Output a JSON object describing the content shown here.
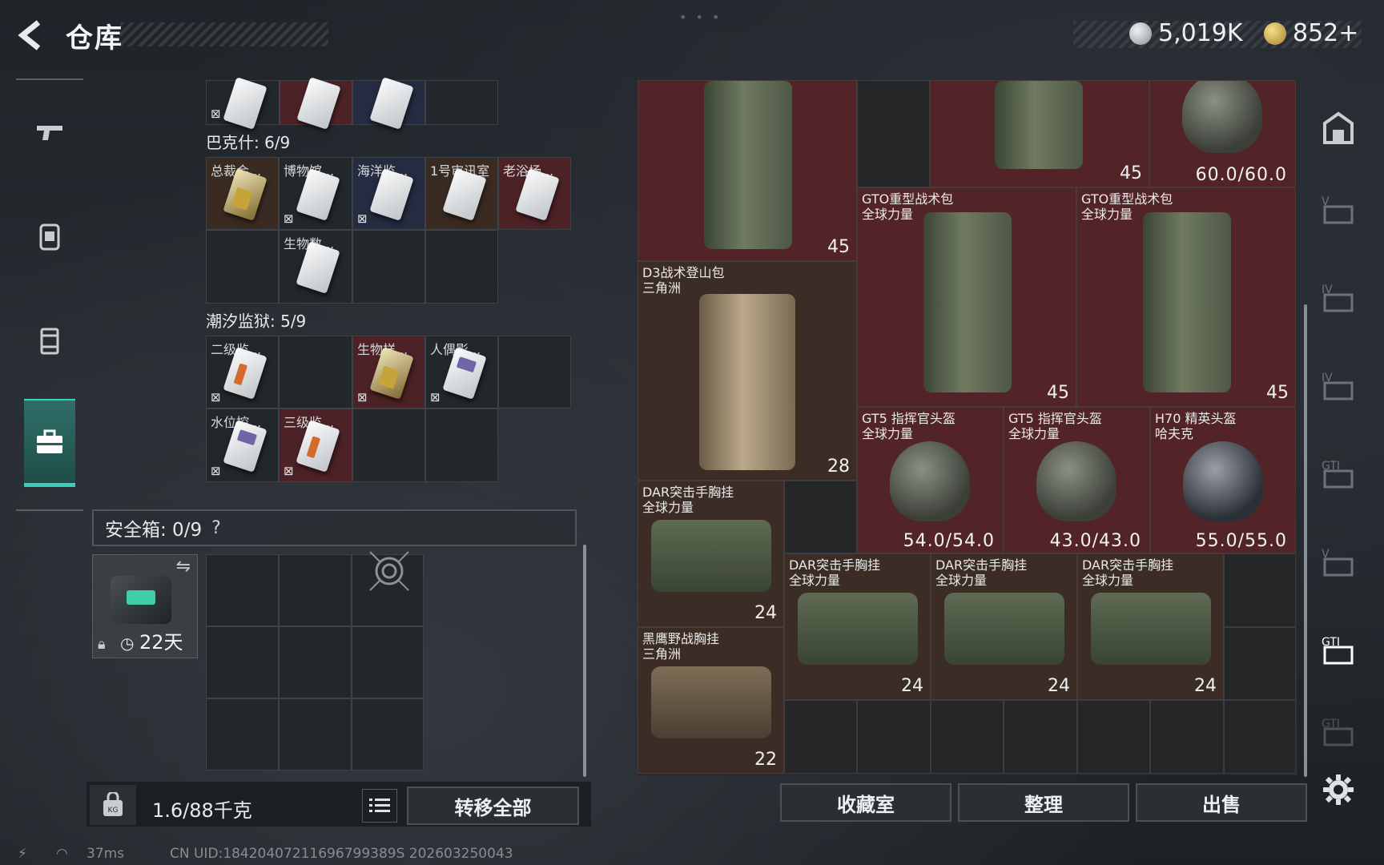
{
  "header": {
    "title": "仓库",
    "currency_silver": "5,019K",
    "currency_gold": "852+",
    "version_text": "--- --- ---"
  },
  "left_panel": {
    "sections": [
      {
        "label": "巴克什: 6/9"
      },
      {
        "label": "潮汐监狱: 5/9"
      }
    ],
    "bakhsh_items": [
      {
        "name": "总裁会..."
      },
      {
        "name": "博物馆..."
      },
      {
        "name": "海洋监..."
      },
      {
        "name": "1号审讯室"
      },
      {
        "name": "老浴场..."
      },
      {
        "name": "生物数..."
      }
    ],
    "tide_items": [
      {
        "name": "二级监..."
      },
      {
        "name": "生物样..."
      },
      {
        "name": "人偶影..."
      },
      {
        "name": "水位控..."
      },
      {
        "name": "三级监..."
      }
    ],
    "safebox": {
      "label": "安全箱: 0/9",
      "help": "?",
      "item_time": "22天"
    },
    "weight": "1.6/88千克",
    "transfer_all": "转移全部"
  },
  "right_panel": {
    "items": [
      {
        "name": "",
        "badge": "45"
      },
      {
        "name": "",
        "badge": "45"
      },
      {
        "name": "",
        "durability": "60.0/60.0"
      },
      {
        "name": "GTO重型战术包\n全球力量",
        "badge": "45"
      },
      {
        "name": "GTO重型战术包\n全球力量",
        "badge": "45"
      },
      {
        "name": "D3战术登山包\n三角洲",
        "badge": "28"
      },
      {
        "name": "GT5 指挥官头盔\n全球力量",
        "durability": "54.0/54.0"
      },
      {
        "name": "GT5 指挥官头盔\n全球力量",
        "durability": "43.0/43.0"
      },
      {
        "name": "H70 精英头盔\n哈夫克",
        "durability": "55.0/55.0"
      },
      {
        "name": "DAR突击手胸挂\n全球力量",
        "badge": "24"
      },
      {
        "name": "DAR突击手胸挂\n全球力量",
        "badge": "24"
      },
      {
        "name": "DAR突击手胸挂\n全球力量",
        "badge": "24"
      },
      {
        "name": "DAR突击手胸挂\n全球力量",
        "badge": "24"
      },
      {
        "name": "黑鹰野战胸挂\n三角洲",
        "badge": "22"
      }
    ],
    "buttons": {
      "collection": "收藏室",
      "organize": "整理",
      "sell": "出售"
    }
  },
  "status": {
    "ping": "37ms",
    "uid": "CN UID:18420407211696799389S 202603250043"
  }
}
